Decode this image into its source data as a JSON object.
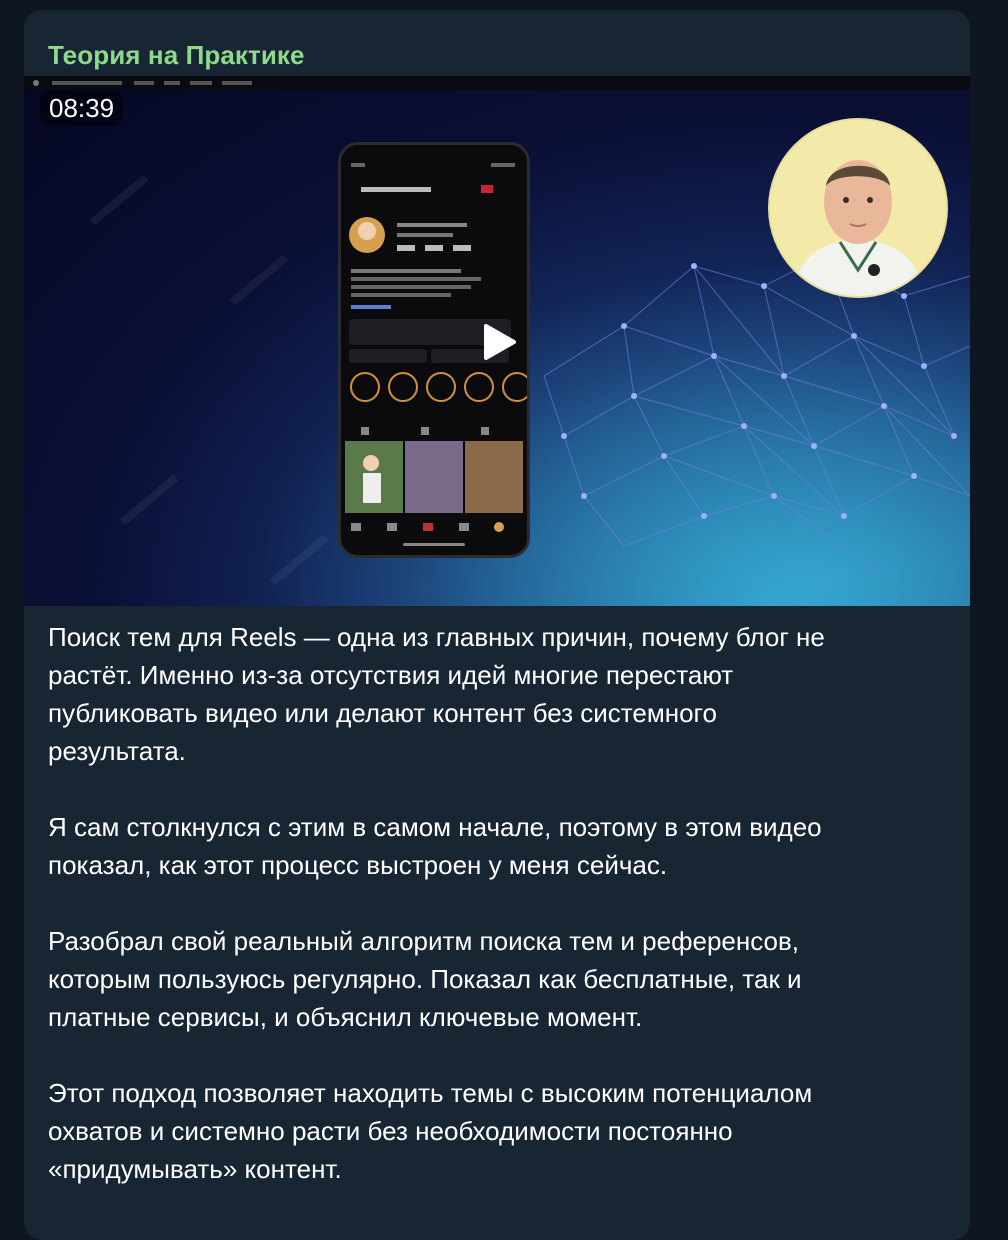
{
  "message": {
    "channel_name": "Теория на Практике",
    "video": {
      "duration": "08:39"
    },
    "paragraphs": [
      "Поиск тем для Reels — одна из главных причин, почему блог не\nрастёт. Именно из-за отсутствия идей многие перестают\nпубликовать видео или делают контент без системного\nрезультата.",
      "Я сам столкнулся с этим в самом начале, поэтому в этом видео\nпоказал, как этот процесс выстроен у меня сейчас.",
      "Разобрал свой реальный алгоритм поиска тем и референсов,\nкоторым пользуюсь регулярно. Показал как бесплатные, так и\nплатные сервисы, и объяснил ключевые момент.",
      "Этот подход позволяет находить темы с высоким потенциалом\nохватов и системно расти без необходимости постоянно\n«придумывать» контент."
    ]
  },
  "colors": {
    "page_bg": "#0e1621",
    "bubble_bg": "#182533",
    "channel_name": "#8fd98b",
    "text": "#ffffff"
  },
  "icons": {
    "play": "play-icon"
  }
}
